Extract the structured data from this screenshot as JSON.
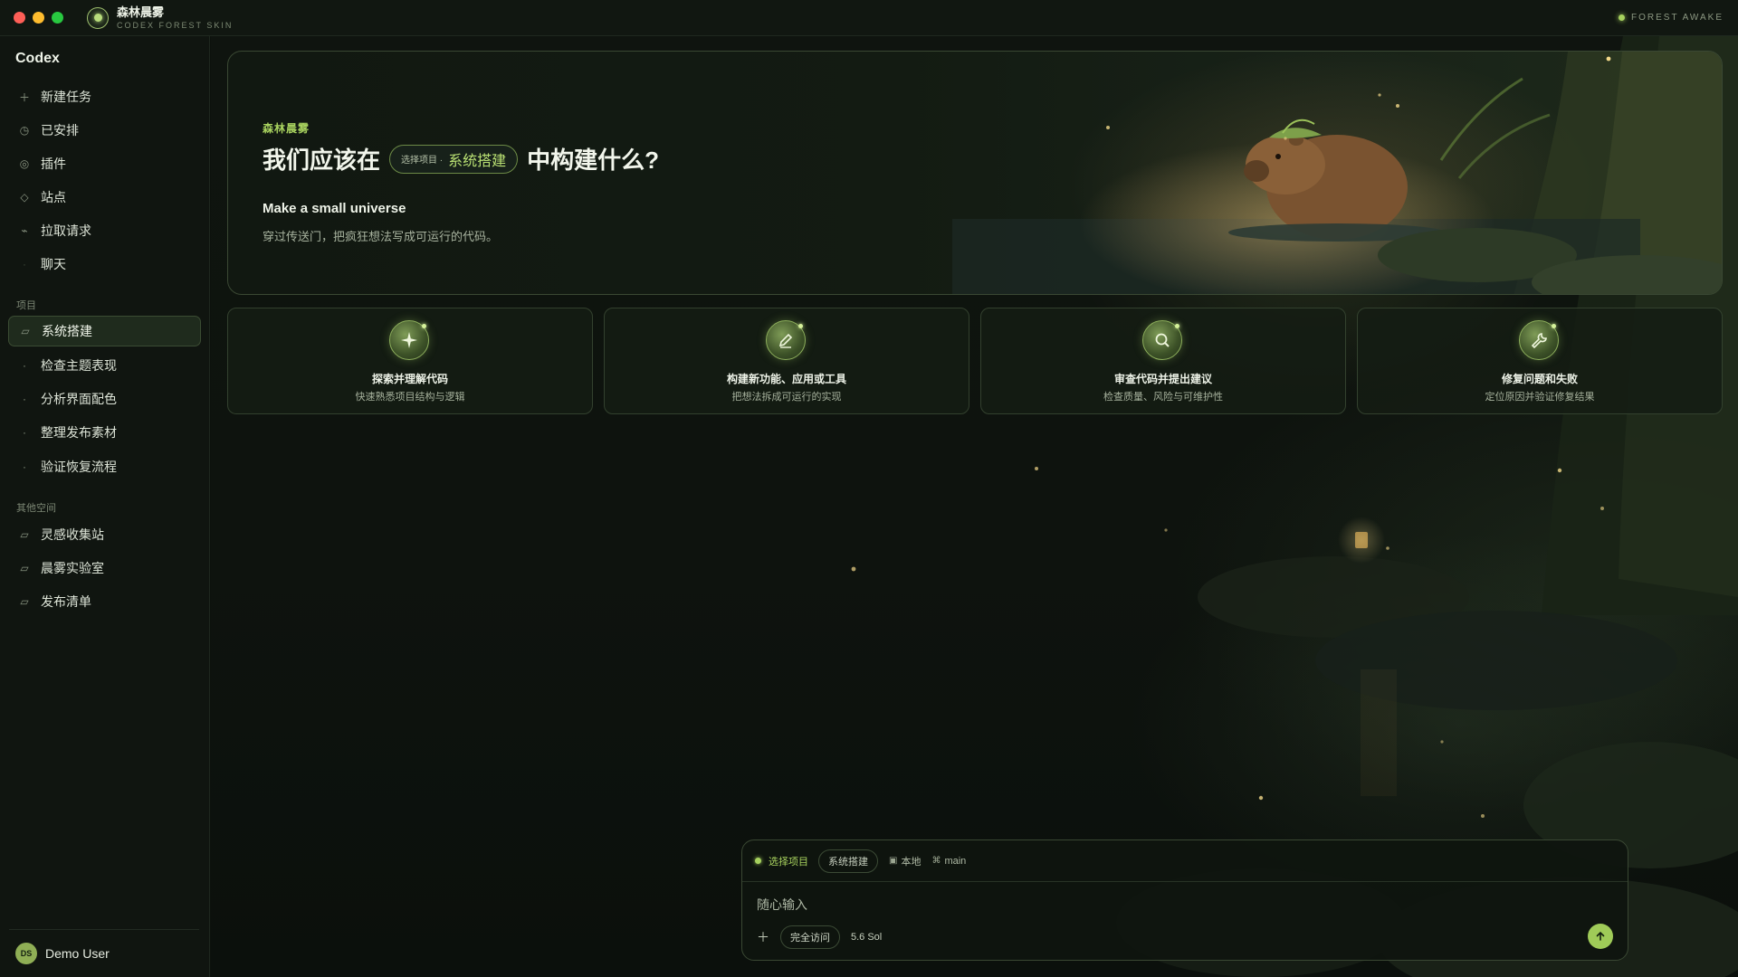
{
  "window": {
    "app_title": "森林晨雾",
    "app_subtitle": "CODEX FOREST SKIN",
    "status_text": "FOREST AWAKE"
  },
  "sidebar": {
    "brand": "Codex",
    "nav": [
      {
        "label": "新建任务",
        "icon": "plus-icon"
      },
      {
        "label": "已安排",
        "icon": "clock-icon"
      },
      {
        "label": "插件",
        "icon": "plugin-icon"
      },
      {
        "label": "站点",
        "icon": "diamond-icon"
      },
      {
        "label": "拉取请求",
        "icon": "pull-request-icon"
      },
      {
        "label": "聊天",
        "icon": "chat-icon"
      }
    ],
    "projects_label": "项目",
    "projects": [
      {
        "label": "系统搭建",
        "icon": "folder-icon",
        "active": true
      },
      {
        "label": "检查主题表现",
        "icon": "dot-icon"
      },
      {
        "label": "分析界面配色",
        "icon": "dot-icon"
      },
      {
        "label": "整理发布素材",
        "icon": "dot-icon"
      },
      {
        "label": "验证恢复流程",
        "icon": "dot-icon"
      }
    ],
    "other_label": "其他空间",
    "others": [
      {
        "label": "灵感收集站",
        "icon": "folder-icon"
      },
      {
        "label": "晨雾实验室",
        "icon": "folder-icon"
      },
      {
        "label": "发布清单",
        "icon": "folder-icon"
      }
    ],
    "user": {
      "initials": "DS",
      "name": "Demo User"
    }
  },
  "hero": {
    "eyebrow": "森林晨雾",
    "title_before": "我们应该在",
    "chip_prefix": "选择项目 ·",
    "chip_value": "系统搭建",
    "title_after": "中构建什么?",
    "subtitle": "Make a small universe",
    "description": "穿过传送门，把疯狂想法写成可运行的代码。"
  },
  "cards": [
    {
      "title": "探索并理解代码",
      "desc": "快速熟悉项目结构与逻辑",
      "icon": "sparkle-icon"
    },
    {
      "title": "构建新功能、应用或工具",
      "desc": "把想法拆成可运行的实现",
      "icon": "pencil-icon"
    },
    {
      "title": "审查代码并提出建议",
      "desc": "检查质量、风险与可维护性",
      "icon": "search-icon"
    },
    {
      "title": "修复问题和失败",
      "desc": "定位原因并验证修复结果",
      "icon": "wrench-icon"
    }
  ],
  "composer": {
    "project_label": "选择项目",
    "project_value": "系统搭建",
    "env_label": "本地",
    "branch_label": "main",
    "placeholder": "随心输入",
    "access_label": "完全访问",
    "model_label": "5.6 Sol"
  },
  "colors": {
    "accent": "#a9d35f",
    "background": "#0c110c",
    "border": "#3a4833"
  }
}
